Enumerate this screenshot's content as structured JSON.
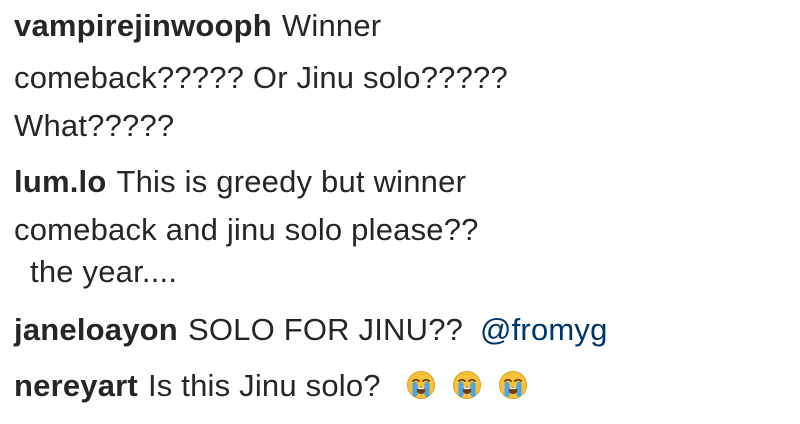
{
  "comments": [
    {
      "username": "vampirejinwooph",
      "lines": [
        "Winner",
        "comeback????? Or Jinu solo?????",
        "What?????"
      ]
    },
    {
      "username": "lum.lo",
      "lines": [
        "This is greedy but winner",
        "comeback and jinu solo please??",
        "the year...."
      ]
    },
    {
      "username": "janeloayon",
      "text": "SOLO FOR JINU??",
      "mention": "@fromyg"
    },
    {
      "username": "nereyart",
      "text": "Is this Jinu solo?",
      "emojis": [
        "loudly-crying-face",
        "loudly-crying-face",
        "loudly-crying-face"
      ]
    }
  ],
  "colors": {
    "text": "#262626",
    "mention": "#003569",
    "emoji_face": "#F7C23A",
    "emoji_tears": "#4DA3E8"
  }
}
